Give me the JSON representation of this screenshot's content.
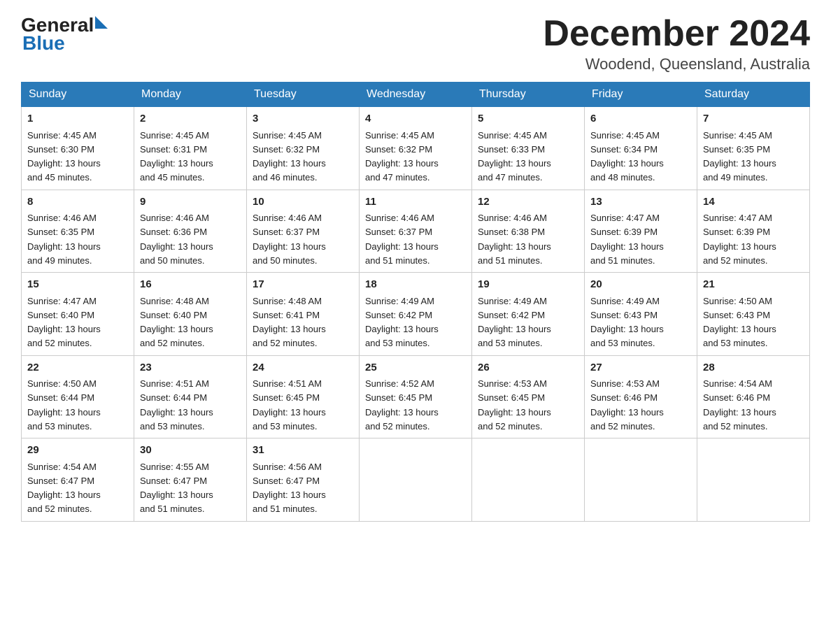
{
  "header": {
    "logo_general": "General",
    "logo_blue": "Blue",
    "title": "December 2024",
    "subtitle": "Woodend, Queensland, Australia"
  },
  "weekdays": [
    "Sunday",
    "Monday",
    "Tuesday",
    "Wednesday",
    "Thursday",
    "Friday",
    "Saturday"
  ],
  "weeks": [
    [
      {
        "day": "1",
        "sunrise": "4:45 AM",
        "sunset": "6:30 PM",
        "daylight": "13 hours and 45 minutes."
      },
      {
        "day": "2",
        "sunrise": "4:45 AM",
        "sunset": "6:31 PM",
        "daylight": "13 hours and 45 minutes."
      },
      {
        "day": "3",
        "sunrise": "4:45 AM",
        "sunset": "6:32 PM",
        "daylight": "13 hours and 46 minutes."
      },
      {
        "day": "4",
        "sunrise": "4:45 AM",
        "sunset": "6:32 PM",
        "daylight": "13 hours and 47 minutes."
      },
      {
        "day": "5",
        "sunrise": "4:45 AM",
        "sunset": "6:33 PM",
        "daylight": "13 hours and 47 minutes."
      },
      {
        "day": "6",
        "sunrise": "4:45 AM",
        "sunset": "6:34 PM",
        "daylight": "13 hours and 48 minutes."
      },
      {
        "day": "7",
        "sunrise": "4:45 AM",
        "sunset": "6:35 PM",
        "daylight": "13 hours and 49 minutes."
      }
    ],
    [
      {
        "day": "8",
        "sunrise": "4:46 AM",
        "sunset": "6:35 PM",
        "daylight": "13 hours and 49 minutes."
      },
      {
        "day": "9",
        "sunrise": "4:46 AM",
        "sunset": "6:36 PM",
        "daylight": "13 hours and 50 minutes."
      },
      {
        "day": "10",
        "sunrise": "4:46 AM",
        "sunset": "6:37 PM",
        "daylight": "13 hours and 50 minutes."
      },
      {
        "day": "11",
        "sunrise": "4:46 AM",
        "sunset": "6:37 PM",
        "daylight": "13 hours and 51 minutes."
      },
      {
        "day": "12",
        "sunrise": "4:46 AM",
        "sunset": "6:38 PM",
        "daylight": "13 hours and 51 minutes."
      },
      {
        "day": "13",
        "sunrise": "4:47 AM",
        "sunset": "6:39 PM",
        "daylight": "13 hours and 51 minutes."
      },
      {
        "day": "14",
        "sunrise": "4:47 AM",
        "sunset": "6:39 PM",
        "daylight": "13 hours and 52 minutes."
      }
    ],
    [
      {
        "day": "15",
        "sunrise": "4:47 AM",
        "sunset": "6:40 PM",
        "daylight": "13 hours and 52 minutes."
      },
      {
        "day": "16",
        "sunrise": "4:48 AM",
        "sunset": "6:40 PM",
        "daylight": "13 hours and 52 minutes."
      },
      {
        "day": "17",
        "sunrise": "4:48 AM",
        "sunset": "6:41 PM",
        "daylight": "13 hours and 52 minutes."
      },
      {
        "day": "18",
        "sunrise": "4:49 AM",
        "sunset": "6:42 PM",
        "daylight": "13 hours and 53 minutes."
      },
      {
        "day": "19",
        "sunrise": "4:49 AM",
        "sunset": "6:42 PM",
        "daylight": "13 hours and 53 minutes."
      },
      {
        "day": "20",
        "sunrise": "4:49 AM",
        "sunset": "6:43 PM",
        "daylight": "13 hours and 53 minutes."
      },
      {
        "day": "21",
        "sunrise": "4:50 AM",
        "sunset": "6:43 PM",
        "daylight": "13 hours and 53 minutes."
      }
    ],
    [
      {
        "day": "22",
        "sunrise": "4:50 AM",
        "sunset": "6:44 PM",
        "daylight": "13 hours and 53 minutes."
      },
      {
        "day": "23",
        "sunrise": "4:51 AM",
        "sunset": "6:44 PM",
        "daylight": "13 hours and 53 minutes."
      },
      {
        "day": "24",
        "sunrise": "4:51 AM",
        "sunset": "6:45 PM",
        "daylight": "13 hours and 53 minutes."
      },
      {
        "day": "25",
        "sunrise": "4:52 AM",
        "sunset": "6:45 PM",
        "daylight": "13 hours and 52 minutes."
      },
      {
        "day": "26",
        "sunrise": "4:53 AM",
        "sunset": "6:45 PM",
        "daylight": "13 hours and 52 minutes."
      },
      {
        "day": "27",
        "sunrise": "4:53 AM",
        "sunset": "6:46 PM",
        "daylight": "13 hours and 52 minutes."
      },
      {
        "day": "28",
        "sunrise": "4:54 AM",
        "sunset": "6:46 PM",
        "daylight": "13 hours and 52 minutes."
      }
    ],
    [
      {
        "day": "29",
        "sunrise": "4:54 AM",
        "sunset": "6:47 PM",
        "daylight": "13 hours and 52 minutes."
      },
      {
        "day": "30",
        "sunrise": "4:55 AM",
        "sunset": "6:47 PM",
        "daylight": "13 hours and 51 minutes."
      },
      {
        "day": "31",
        "sunrise": "4:56 AM",
        "sunset": "6:47 PM",
        "daylight": "13 hours and 51 minutes."
      },
      null,
      null,
      null,
      null
    ]
  ],
  "labels": {
    "sunrise": "Sunrise:",
    "sunset": "Sunset:",
    "daylight": "Daylight:"
  }
}
